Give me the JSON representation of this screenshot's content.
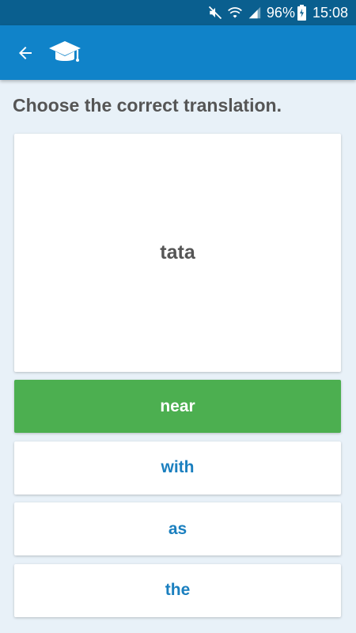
{
  "status_bar": {
    "battery": "96%",
    "time": "15:08",
    "icons": [
      "mute-icon",
      "wifi-icon",
      "signal-icon",
      "battery-charging-icon"
    ]
  },
  "app_bar": {
    "color": "#1083c9",
    "back_icon": "back-arrow-icon",
    "logo_icon": "graduation-cap-icon"
  },
  "quiz": {
    "prompt": "Choose the correct translation.",
    "word": "tata",
    "answers": [
      {
        "label": "near",
        "state": "correct"
      },
      {
        "label": "with",
        "state": "default"
      },
      {
        "label": "as",
        "state": "default"
      },
      {
        "label": "the",
        "state": "default"
      }
    ]
  },
  "colors": {
    "correct": "#4caf50",
    "answer_text": "#1a7fbf",
    "background": "#e8f1f8"
  }
}
